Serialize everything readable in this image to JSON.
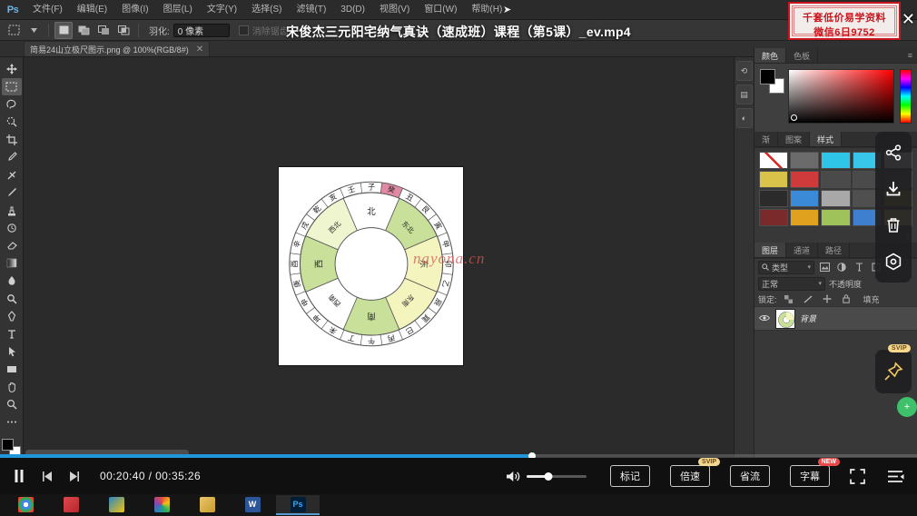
{
  "app": {
    "name": "Photoshop",
    "logo": "Ps"
  },
  "menubar": {
    "items": [
      {
        "label": "文件(F)",
        "name": "menu-file"
      },
      {
        "label": "编辑(E)",
        "name": "menu-edit"
      },
      {
        "label": "图像(I)",
        "name": "menu-image"
      },
      {
        "label": "图层(L)",
        "name": "menu-layer"
      },
      {
        "label": "文字(Y)",
        "name": "menu-type"
      },
      {
        "label": "选择(S)",
        "name": "menu-select"
      },
      {
        "label": "滤镜(T)",
        "name": "menu-filter"
      },
      {
        "label": "3D(D)",
        "name": "menu-3d"
      },
      {
        "label": "视图(V)",
        "name": "menu-view"
      },
      {
        "label": "窗口(W)",
        "name": "menu-window"
      },
      {
        "label": "帮助(H)",
        "name": "menu-help"
      }
    ]
  },
  "options_bar": {
    "tool_icon": "rectangular-marquee-icon",
    "feather_label": "羽化:",
    "feather_value": "0 像素",
    "antialias_label": "消除锯齿",
    "selection_modes": [
      "new-selection",
      "add-to-selection",
      "subtract-from-selection",
      "intersect-selection"
    ]
  },
  "video": {
    "title": "宋俊杰三元阳宅纳气真诀（速成班）课程（第5课）_ev.mp4",
    "current_time": "00:20:40",
    "total_time": "00:35:26",
    "time_display": "00:20:40 / 00:35:26",
    "progress_percent": 58,
    "volume_percent": 36
  },
  "ad_banner": {
    "line1": "千套低价易学资料",
    "line2": "微信6日9752",
    "close": "✕"
  },
  "document_tab": {
    "label": "简易24山立极尺图示.png @ 100%(RGB/8#)",
    "close": "✕"
  },
  "toolbar": {
    "tools": [
      {
        "name": "move-tool",
        "glyph": "✛"
      },
      {
        "name": "rectangular-marquee-tool",
        "glyph": "▭"
      },
      {
        "name": "lasso-tool",
        "glyph": "◠"
      },
      {
        "name": "quick-selection-tool",
        "glyph": "✧"
      },
      {
        "name": "crop-tool",
        "glyph": "⌗"
      },
      {
        "name": "eyedropper-tool",
        "glyph": "✐"
      },
      {
        "name": "spot-healing-brush-tool",
        "glyph": "✜"
      },
      {
        "name": "brush-tool",
        "glyph": "✎"
      },
      {
        "name": "clone-stamp-tool",
        "glyph": "⎙"
      },
      {
        "name": "history-brush-tool",
        "glyph": "✇"
      },
      {
        "name": "eraser-tool",
        "glyph": "◳"
      },
      {
        "name": "gradient-tool",
        "glyph": "▤"
      },
      {
        "name": "blur-tool",
        "glyph": "◌"
      },
      {
        "name": "dodge-tool",
        "glyph": "●"
      },
      {
        "name": "pen-tool",
        "glyph": "✒"
      },
      {
        "name": "horizontal-type-tool",
        "glyph": "T"
      },
      {
        "name": "path-selection-tool",
        "glyph": "➤"
      },
      {
        "name": "rectangle-tool",
        "glyph": "▬"
      },
      {
        "name": "hand-tool",
        "glyph": "✋"
      },
      {
        "name": "zoom-tool",
        "glyph": "🔍"
      },
      {
        "name": "edit-toolbar",
        "glyph": "⋯"
      }
    ],
    "foreground_color": "#000000",
    "background_color": "#ffffff"
  },
  "panels": {
    "color_group": {
      "tabs": [
        {
          "label": "颜色",
          "selected": true
        },
        {
          "label": "色板",
          "selected": false
        }
      ],
      "menu_glyph": "≡"
    },
    "styles_group": {
      "tabs": [
        {
          "label": "渐",
          "selected": false
        },
        {
          "label": "图案",
          "selected": false
        },
        {
          "label": "样式",
          "selected": true
        }
      ],
      "swatches": [
        "none",
        "#6b6b6b",
        "#2fc5e8",
        "#38c6ea",
        "#e9f3f0",
        "#d8c24a",
        "#cf3a3a",
        "#4a4a4a",
        "#4a4a4a",
        "#4a4a4a",
        "#2b2b2b",
        "#3b8ad8",
        "#a8a8a8",
        "#4f4f4f",
        "#9a7a2a",
        "#7a2a2a",
        "#e0a21e",
        "#9fc25a",
        "#3f7fd0",
        "#d8c060"
      ],
      "footer_glyph": "⊘"
    },
    "layers_group": {
      "tabs": [
        {
          "label": "图层",
          "selected": true
        },
        {
          "label": "通道",
          "selected": false
        },
        {
          "label": "路径",
          "selected": false
        }
      ],
      "filter_label": "类型",
      "filter_icon": "search-icon",
      "filter_buttons": [
        "image-filter-icon",
        "adjustment-filter-icon",
        "type-filter-icon",
        "shape-filter-icon"
      ],
      "blend_mode": "正常",
      "opacity_label": "不透明度",
      "lock_label": "锁定:",
      "fill_label": "填充",
      "lock_icons": [
        "lock-transparent-icon",
        "lock-image-icon",
        "lock-position-icon",
        "lock-all-icon"
      ],
      "layers": [
        {
          "name": "背景",
          "visible": true,
          "locked": true
        }
      ]
    }
  },
  "dock_strip": {
    "buttons": [
      {
        "name": "history-dock-icon",
        "glyph": "⟲"
      },
      {
        "name": "properties-dock-icon",
        "glyph": "▤"
      },
      {
        "name": "adjustments-dock-icon",
        "glyph": "◐"
      }
    ]
  },
  "float_actions": {
    "buttons": [
      {
        "name": "share-button",
        "glyph": "share-icon"
      },
      {
        "name": "download-button",
        "glyph": "download-icon"
      },
      {
        "name": "delete-button",
        "glyph": "trash-icon"
      },
      {
        "name": "record-button",
        "glyph": "record-icon"
      }
    ],
    "pin": {
      "name": "pin-button",
      "badge": "SVIP",
      "glyph": "pin-icon"
    },
    "green": {
      "name": "float-green-button",
      "glyph": "+"
    }
  },
  "player": {
    "pause_label": "⏸",
    "prev_label": "◀",
    "next_label": "▶",
    "volume_icon": "volume-icon",
    "buttons": [
      {
        "label": "标记",
        "name": "mark-button",
        "badge": null
      },
      {
        "label": "倍速",
        "name": "speed-button",
        "badge": "SVIP"
      },
      {
        "label": "省流",
        "name": "save-data-button",
        "badge": null
      },
      {
        "label": "字幕",
        "name": "subtitle-button",
        "badge": "NEW"
      }
    ],
    "fullscreen_icon": "fullscreen-icon",
    "playlist_icon": "playlist-icon"
  },
  "taskbar": {
    "items": [
      {
        "name": "taskbar-chrome",
        "label": "",
        "color": "#3a7ad0"
      },
      {
        "name": "taskbar-app2",
        "label": "",
        "color": "#c0392b"
      },
      {
        "name": "taskbar-app3",
        "label": "",
        "color": "#2e86c1"
      },
      {
        "name": "taskbar-app4",
        "label": "",
        "color": "#8e44ad"
      },
      {
        "name": "taskbar-explorer",
        "label": "",
        "color": "#d6b24a"
      },
      {
        "name": "taskbar-word",
        "label": "W",
        "color": "#2b579a"
      },
      {
        "name": "taskbar-photoshop",
        "label": "Ps",
        "color": "#001e36"
      }
    ]
  },
  "watermark": {
    "text": "nayona.cn"
  },
  "compass": {
    "title": "简易24山立极尺图示",
    "center_labels": [
      {
        "text": "北",
        "angle": 0
      },
      {
        "text": "东北",
        "angle": 45
      },
      {
        "text": "东",
        "angle": 90
      },
      {
        "text": "东南",
        "angle": 135
      },
      {
        "text": "南",
        "angle": 180
      },
      {
        "text": "西南",
        "angle": 225
      },
      {
        "text": "西",
        "angle": 270
      },
      {
        "text": "西北",
        "angle": 315
      }
    ],
    "sector_colors": [
      "#e9f2cd",
      "#f4f4bf",
      "#c8e09a",
      "#ffffff",
      "#c8e09a",
      "#f4f4bf",
      "#c8e09a",
      "#ffffff"
    ],
    "mountains": [
      {
        "text": "子",
        "highlight": false
      },
      {
        "text": "癸",
        "highlight": true
      },
      {
        "text": "丑",
        "highlight": false
      },
      {
        "text": "艮",
        "highlight": false
      },
      {
        "text": "寅",
        "highlight": false
      },
      {
        "text": "甲",
        "highlight": false
      },
      {
        "text": "卯",
        "highlight": false
      },
      {
        "text": "乙",
        "highlight": false
      },
      {
        "text": "辰",
        "highlight": false
      },
      {
        "text": "巽",
        "highlight": false
      },
      {
        "text": "巳",
        "highlight": false
      },
      {
        "text": "丙",
        "highlight": false
      },
      {
        "text": "午",
        "highlight": false
      },
      {
        "text": "丁",
        "highlight": false
      },
      {
        "text": "未",
        "highlight": false
      },
      {
        "text": "坤",
        "highlight": false
      },
      {
        "text": "申",
        "highlight": false
      },
      {
        "text": "庚",
        "highlight": false
      },
      {
        "text": "酉",
        "highlight": false
      },
      {
        "text": "辛",
        "highlight": false
      },
      {
        "text": "戌",
        "highlight": false
      },
      {
        "text": "乾",
        "highlight": false
      },
      {
        "text": "亥",
        "highlight": false
      },
      {
        "text": "壬",
        "highlight": false
      }
    ]
  }
}
